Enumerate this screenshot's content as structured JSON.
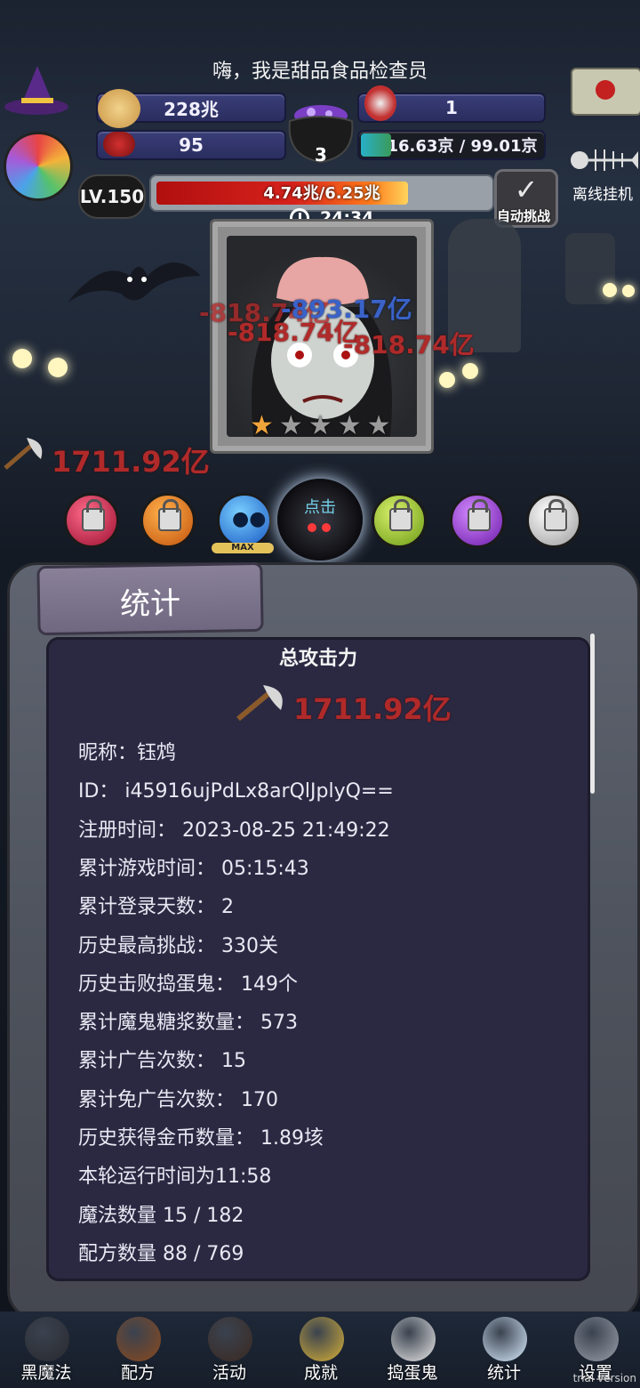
{
  "header": {
    "greeting": "嗨，我是甜品食品检查员",
    "resources": {
      "cookies": "228兆",
      "candy": "95",
      "cauldron_count": "3",
      "skull_potion": "1",
      "experience": "16.63京 / 99.01京"
    },
    "offline_label": "离线挂机",
    "level": "LV.150",
    "hp_text": "4.74兆/6.25兆",
    "hp_fraction": 0.76,
    "timer": "24:34",
    "auto_challenge_label": "自动挑战",
    "orb_max_label": "MAX",
    "active_orb_label": "点击"
  },
  "battle": {
    "damage_numbers": [
      "-818.74亿",
      "-893.17亿",
      "-818.74亿",
      "-818.74亿"
    ],
    "total_attack_display": "1711.92亿",
    "stars_filled": 1,
    "stars_total": 5
  },
  "stats_panel": {
    "tab_title": "统计",
    "section_title": "总攻击力",
    "total_attack": "1711.92亿",
    "rows": [
      "昵称：钰鸩",
      "ID： i45916ujPdLx8arQlJplyQ==",
      "注册时间： 2023-08-25 21:49:22",
      "累计游戏时间： 05:15:43",
      "累计登录天数： 2",
      "历史最高挑战： 330关",
      "历史击败捣蛋鬼： 149个",
      "累计魔鬼糖浆数量： 573",
      "累计广告次数： 15",
      "累计免广告次数： 170",
      "历史获得金币数量： 1.89垓",
      "本轮运行时间为11:58",
      "魔法数量 15 / 182",
      "配方数量 88 / 769"
    ]
  },
  "nav": {
    "items": [
      {
        "label": "黑魔法",
        "icon": "demon-icon"
      },
      {
        "label": "配方",
        "icon": "recipe-book-icon"
      },
      {
        "label": "活动",
        "icon": "event-cake-icon"
      },
      {
        "label": "成就",
        "icon": "trophy-icon"
      },
      {
        "label": "捣蛋鬼",
        "icon": "ghost-icon"
      },
      {
        "label": "统计",
        "icon": "crystal-ball-icon"
      },
      {
        "label": "设置",
        "icon": "gear-icon"
      }
    ],
    "trial_text": "trial version"
  },
  "colors": {
    "accent_red": "#b02a2a",
    "panel_bg": "#2b2942",
    "hp_fill": "#d8221c"
  }
}
